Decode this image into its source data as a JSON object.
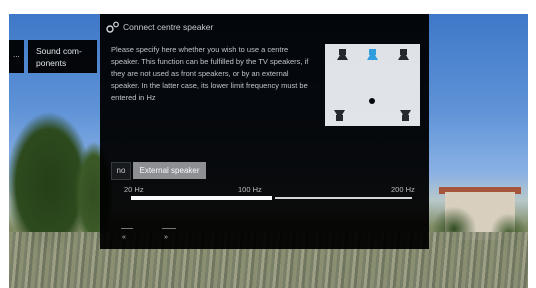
{
  "sidebar": {
    "stub_label": "...",
    "item_label": "Sound com-\nponents"
  },
  "dialog": {
    "title": "Connect centre speaker",
    "description": "Please specify here whether you wish to use a centre speaker. This function can be fulfilled by the TV speakers, if they are not used as front speakers, or by an external speaker. In the latter case, its lower limit frequency must be entered in Hz",
    "options": [
      "no",
      "External speaker"
    ],
    "selected_option": "External speaker",
    "slider": {
      "ticks": [
        "20 Hz",
        "100 Hz",
        "200 Hz"
      ],
      "min": 20,
      "max": 200,
      "value": 110,
      "unit": "Hz"
    },
    "nav": {
      "prev": "«",
      "next": "»"
    }
  },
  "diagram": {
    "icons": [
      "front-left-speaker-icon",
      "centre-speaker-icon",
      "front-right-speaker-icon",
      "rear-left-speaker-icon",
      "listener-icon",
      "rear-right-speaker-icon"
    ],
    "highlight_color": "#2e9fe0"
  }
}
